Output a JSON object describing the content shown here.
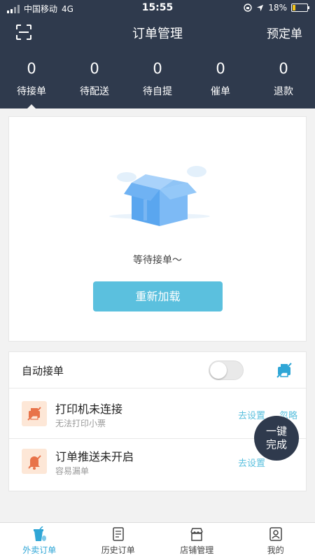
{
  "status_bar": {
    "carrier": "中国移动",
    "network": "4G",
    "time": "15:55",
    "battery": "18%"
  },
  "navbar": {
    "title": "订单管理",
    "right_action": "预定单",
    "left_icon": "scan-icon"
  },
  "stats": [
    {
      "count": "0",
      "label": "待接单"
    },
    {
      "count": "0",
      "label": "待配送"
    },
    {
      "count": "0",
      "label": "待自提"
    },
    {
      "count": "0",
      "label": "催单"
    },
    {
      "count": "0",
      "label": "退款"
    }
  ],
  "empty_state": {
    "message": "等待接单～",
    "reload_label": "重新加载"
  },
  "settings": {
    "auto_accept_label": "自动接单",
    "auto_accept_on": false,
    "printer": {
      "title": "打印机未连接",
      "subtitle": "无法打印小票",
      "setup_label": "去设置",
      "ignore_label": "忽略"
    },
    "push": {
      "title": "订单推送未开启",
      "subtitle": "容易漏单",
      "setup_label": "去设置"
    }
  },
  "fab": {
    "line1": "一键",
    "line2": "完成"
  },
  "tabs": [
    {
      "label": "外卖订单",
      "icon": "takeout-cup-icon",
      "active": true
    },
    {
      "label": "历史订单",
      "icon": "history-doc-icon",
      "active": false
    },
    {
      "label": "店铺管理",
      "icon": "shop-icon",
      "active": false
    },
    {
      "label": "我的",
      "icon": "profile-icon",
      "active": false
    }
  ],
  "colors": {
    "header_bg": "#2f3a4d",
    "accent": "#5bc0de",
    "active_tab": "#2fa6d6",
    "warn_icon_bg": "#fde7d7",
    "warn_icon_fg": "#e8734a"
  }
}
